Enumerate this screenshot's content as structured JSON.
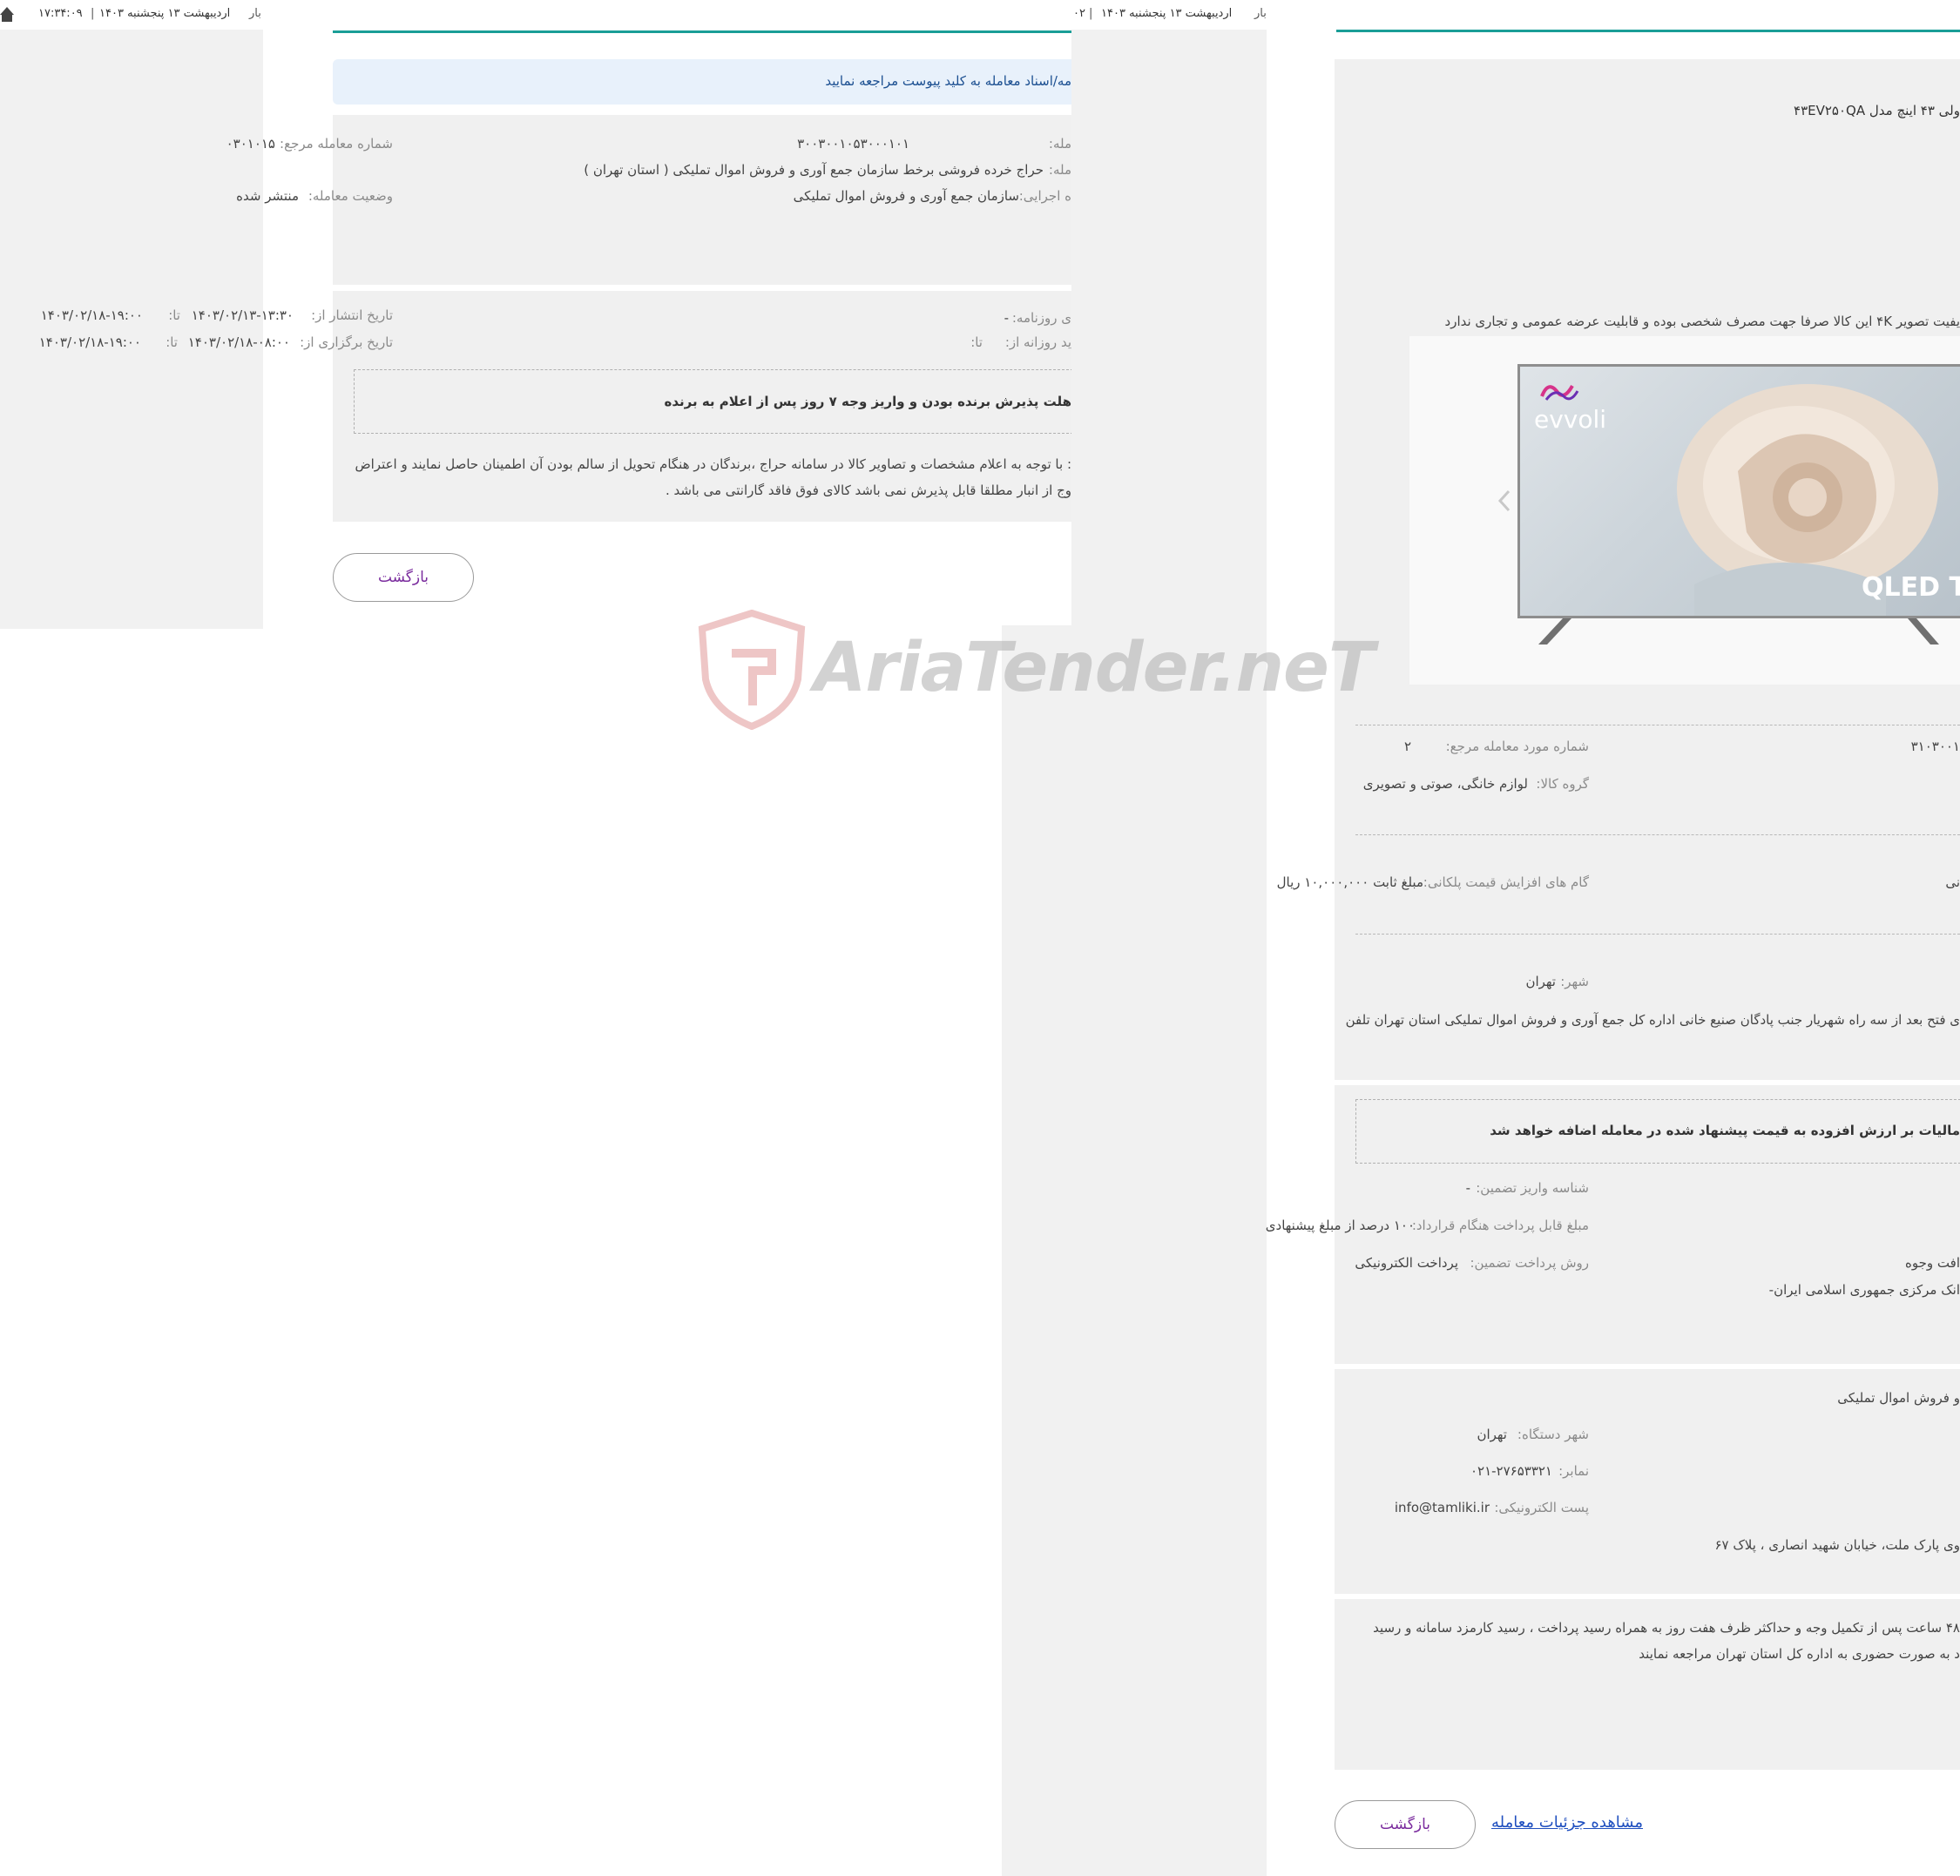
{
  "left_window": {
    "topbar_text": "اردیبهشت ۱۳ پنجشنبه ۱۴۰۳",
    "topbar_time": "۱۷:۳۴:۰۹",
    "topbar_cut": "بار",
    "notice": "مه/اسناد معامله به کلید پیوست مراجعه نمایید",
    "fields": {
      "deal_number_label": "مله:",
      "deal_number_value": "۳۰۰۳۰۰۱۰۵۳۰۰۰۱۰۱",
      "ref_number_label": "شماره معامله مرجع:",
      "ref_number_value": "۰۳۰۱۰۱۵",
      "title_label": "مله:",
      "title_value": "حراج خرده فروشی برخط سازمان جمع آوری و فروش اموال تملیکی ( استان تهران )",
      "executor_label": "ه اجرایی:",
      "executor_value": "سازمان جمع آوری و فروش اموال تملیکی",
      "status_label": "وضعیت معامله:",
      "status_value": "منتشر شده",
      "newspaper_label": "ی روزنامه:",
      "newspaper_value": "-",
      "publish_label": "تاریخ انتشار از:",
      "publish_from": "۱۴۰۳/۰۲/۱۳-۱۳:۳۰",
      "publish_to_label": "تا:",
      "publish_to": "۱۴۰۳/۰۲/۱۸-۱۹:۰۰",
      "daily_label": "ید روزانه از:",
      "daily_to_label": "تا:",
      "hold_label": "تاریخ برگزاری از:",
      "hold_from": "۱۴۰۳/۰۲/۱۸-۰۸:۰۰",
      "hold_to_label": "تا:",
      "hold_to": "۱۴۰۳/۰۲/۱۸-۱۹:۰۰"
    },
    "deadline_box": "هلت پذیرش برنده بودن و واریز وجه ۷ روز پس از اعلام به برنده",
    "desc_line1": ": با توجه به اعلام مشخصات و تصاویر کالا در سامانه حراج ،برندگان در هنگام تحویل از سالم بودن آن اطمینان حاصل نمایند و اعتراض",
    "desc_line2": "وج از انبار مطلقا قابل پذیرش نمی باشد کالای فوق فاقد گارانتی می باشد .",
    "back_button": "بازگشت"
  },
  "mid_topbar": {
    "text": "اردیبهشت ۱۳ پنجشنبه ۱۴۰۳",
    "left_cut": "۰۲",
    "right_cut": "بار"
  },
  "right_window": {
    "product_title": "ولی ۴۳ اینچ مدل ۴۳EV۲۵۰QA",
    "product_note": "یفیت تصویر ۴K این کالا صرفا جهت مصرف شخصی بوده و قابلیت عرضه عمومی و تجاری ندارد",
    "image": {
      "brand": "evvoli",
      "badge": "QLED TV"
    },
    "ref_item_label": "شماره مورد معامله مرجع:",
    "ref_item_value": "۲",
    "ref_cut_value": "۳۱۰۳۰۰۱",
    "goods_group_label": "گروه کالا:",
    "goods_group_value": "لوازم خانگی، صوتی و تصویری",
    "step_label": "گام های افزایش قیمت پلکانی:",
    "step_value": "مبلغ ثابت ۱۰,۰۰۰,۰۰۰ ریال",
    "step_cut": "نی",
    "city_label": "شهر:",
    "city_value": "تهران",
    "address_line": "ی فتح بعد از سه راه شهریار جنب پادگان صنیع خانی اداره کل جمع آوری و فروش اموال تملیکی استان تهران تلفن",
    "vat_box": "مالیات بر ارزش افزوده به قیمت پیشنهاد شده در معامله اضافه خواهد شد",
    "guarantee_id_label": "شناسه واریز تضمین:",
    "guarantee_id_value": "-",
    "contract_pay_label": "مبلغ قابل پرداخت هنگام قرارداد:",
    "contract_pay_value": "۱۰۰ درصد از مبلغ پیشنهادی",
    "guarantee_method_label": "روش پرداخت تضمین:",
    "guarantee_method_value": "پرداخت الکترونیکی",
    "receive_cut": "افت وجوه",
    "bank_cut": "انک مرکزی جمهوری اسلامی ایران-",
    "org_cut": "و فروش اموال تملیکی",
    "org_city_label": "شهر دستگاه:",
    "org_city_value": "تهران",
    "fax_label": "نمابر:",
    "fax_value": "۰۲۱-۲۷۶۵۳۳۲۱",
    "email_label": "پست الکترونیکی:",
    "email_value": "info@tamliki.ir",
    "org_address": "وی پارک ملت، خیابان شهید انصاری ، پلاک ۶۷",
    "final_line1": "۴۸ ساعت پس از تکمیل وجه و حداکثر ظرف هفت روز به همراه رسید پرداخت ، رسید کارمزد سامانه و رسید",
    "final_line2": "د به صورت حضوری به اداره کل استان تهران مراجعه نمایند",
    "details_link": "مشاهده جزئیات معامله",
    "back_button": "بازگشت"
  },
  "watermark": "AriaTender.neT",
  "colors": {
    "teal": "#1a9e97",
    "panel": "#f0f0f0",
    "notice_bg": "#e8f1fb",
    "button_text": "#7b2d9e",
    "link": "#1f4fbf"
  }
}
